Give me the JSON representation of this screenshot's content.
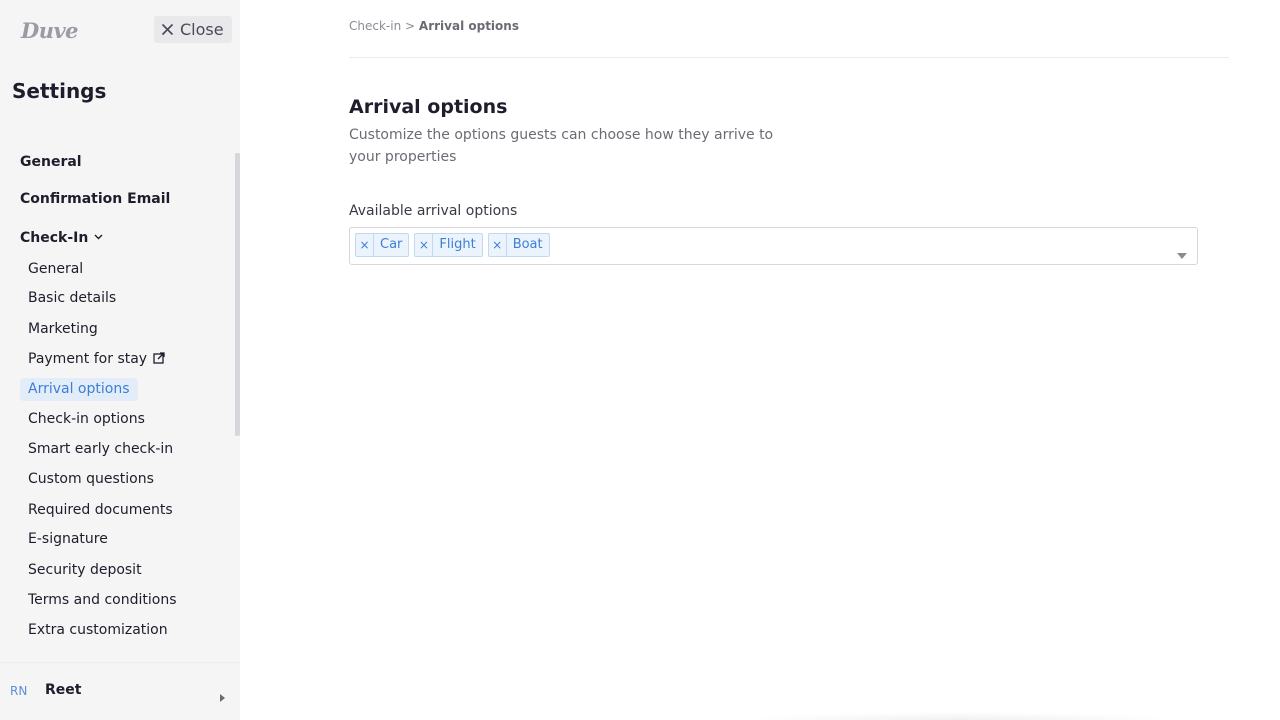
{
  "sidebar": {
    "logo": "Duve",
    "close_label": "Close",
    "title": "Settings",
    "top_items": [
      {
        "label": "General"
      },
      {
        "label": "Confirmation Email"
      },
      {
        "label": "Check-In"
      }
    ],
    "checkin_items": [
      {
        "label": "General"
      },
      {
        "label": "Basic details"
      },
      {
        "label": "Marketing"
      },
      {
        "label": "Payment for stay"
      },
      {
        "label": "Arrival options"
      },
      {
        "label": "Check-in options"
      },
      {
        "label": "Smart early check-in"
      },
      {
        "label": "Custom questions"
      },
      {
        "label": "Required documents"
      },
      {
        "label": "E-signature"
      },
      {
        "label": "Security deposit"
      },
      {
        "label": "Terms and conditions"
      },
      {
        "label": "Extra customization"
      }
    ],
    "active_item": "Arrival options",
    "user": {
      "initials": "RN",
      "name": "Reet"
    }
  },
  "main": {
    "breadcrumb": {
      "parent": "Check-in",
      "separator": ">",
      "current": "Arrival options"
    },
    "title": "Arrival options",
    "description": "Customize the options guests can choose how they arrive to your properties",
    "field_label": "Available arrival options",
    "selected_options": [
      "Car",
      "Flight",
      "Boat"
    ]
  },
  "colors": {
    "accent": "#3d7fd6",
    "active_bg": "#e3ecf9",
    "sidebar_bg": "#f5f5f6"
  }
}
